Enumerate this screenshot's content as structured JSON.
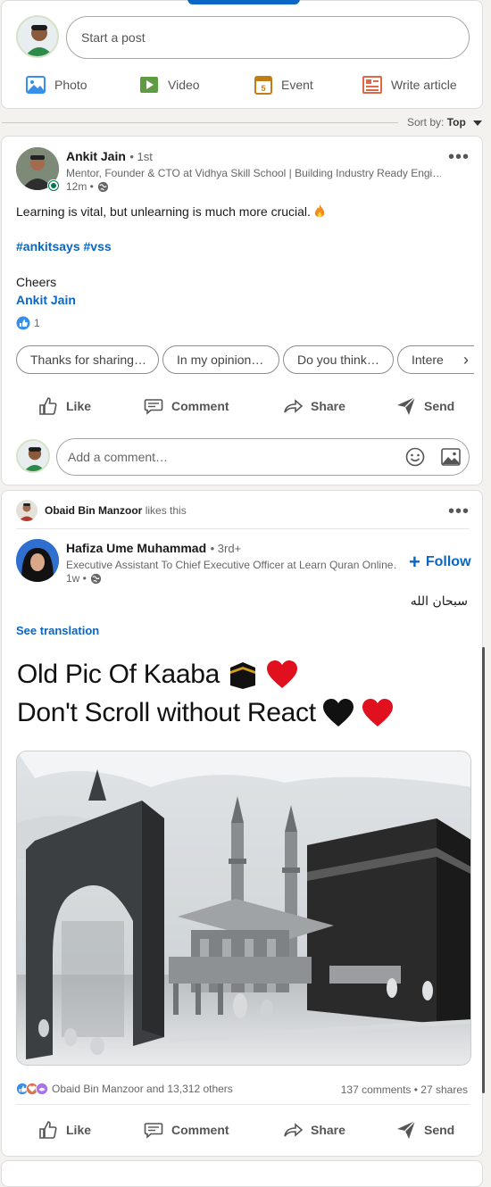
{
  "share_box": {
    "placeholder": "Start a post",
    "options": [
      {
        "label": "Photo",
        "icon": "photo-icon",
        "color": "#378fe9"
      },
      {
        "label": "Video",
        "icon": "video-icon",
        "color": "#5f9b41"
      },
      {
        "label": "Event",
        "icon": "event-icon",
        "color": "#c37d16"
      },
      {
        "label": "Write article",
        "icon": "article-icon",
        "color": "#e06847"
      }
    ]
  },
  "sort": {
    "label": "Sort by:",
    "value": "Top"
  },
  "post1": {
    "author": "Ankit Jain",
    "degree": "• 1st",
    "headline": "Mentor, Founder & CTO at Vidhya Skill School | Building Industry Ready Engi…",
    "time": "12m •",
    "body": "Learning is vital, but unlearning is much more crucial.",
    "hashtags": "#ankitsays #vss",
    "closing": "Cheers",
    "signature": "Ankit Jain",
    "reaction_count": "1",
    "suggestions": [
      "Thanks for sharing…",
      "In my opinion…",
      "Do you think…",
      "Intere"
    ],
    "actions": [
      "Like",
      "Comment",
      "Share",
      "Send"
    ],
    "comment_placeholder": "Add a comment…"
  },
  "post2": {
    "liker": "Obaid Bin Manzoor",
    "liker_suffix": "likes this",
    "author": "Hafiza Ume Muhammad",
    "degree": "• 3rd+",
    "headline": "Executive Assistant To Chief Executive Officer at Learn Quran Online…",
    "time": "1w •",
    "follow": "Follow",
    "body": "سبحان الله",
    "see_translation": "See translation",
    "image_line1": "Old Pic Of Kaaba",
    "image_line2": "Don't Scroll without React",
    "reactions_text": "Obaid Bin Manzoor and 13,312 others",
    "comments_shares": "137 comments • 27 shares",
    "actions": [
      "Like",
      "Comment",
      "Share",
      "Send"
    ]
  }
}
